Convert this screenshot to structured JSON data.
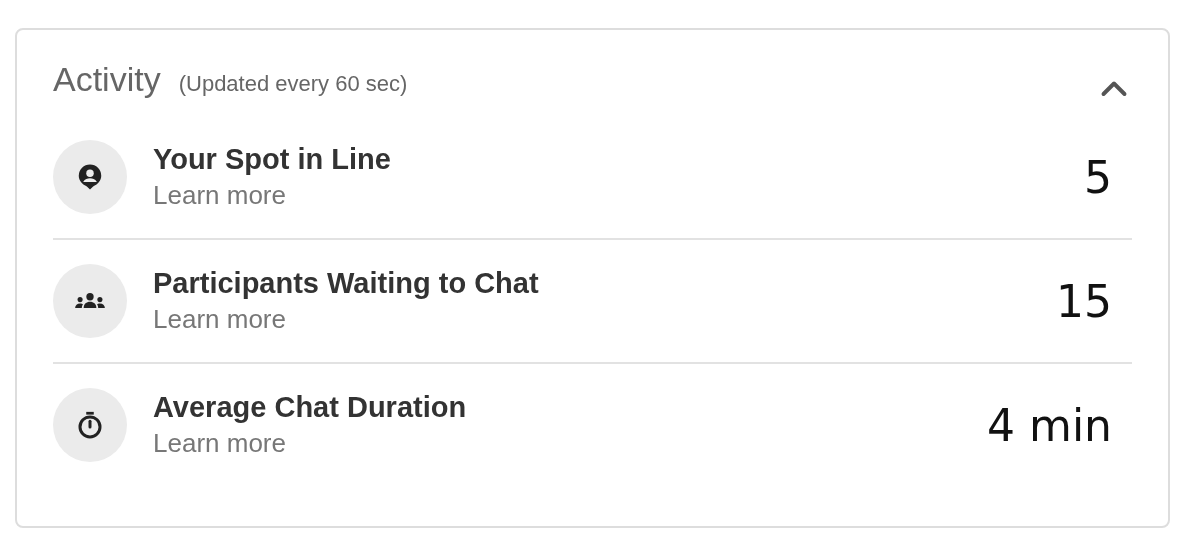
{
  "panel": {
    "title": "Activity",
    "subtitle": "(Updated every 60 sec)",
    "expanded": true
  },
  "rows": [
    {
      "kind": "spot",
      "label": "Your Spot in Line",
      "link": "Learn more",
      "value": "5"
    },
    {
      "kind": "group",
      "label": "Participants Waiting to Chat",
      "link": "Learn more",
      "value": "15"
    },
    {
      "kind": "timer",
      "label": "Average Chat Duration",
      "link": "Learn more",
      "value": "4 min"
    }
  ]
}
